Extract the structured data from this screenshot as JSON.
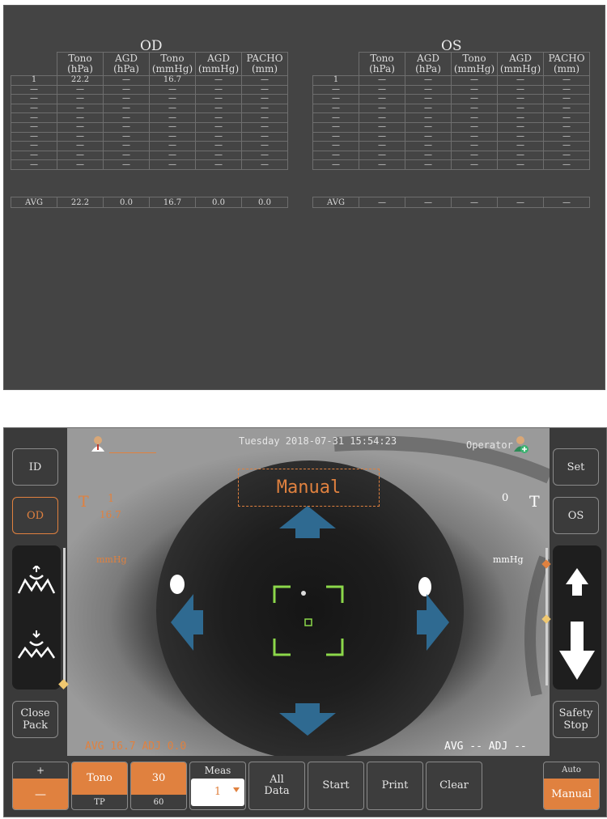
{
  "data_panel": {
    "od": {
      "title": "OD",
      "headers": [
        {
          "line1": "Tono",
          "line2": "(hPa)"
        },
        {
          "line1": "AGD",
          "line2": "(hPa)"
        },
        {
          "line1": "Tono",
          "line2": "(mmHg)"
        },
        {
          "line1": "AGD",
          "line2": "(mmHg)"
        },
        {
          "line1": "PACHO",
          "line2": "(mm)"
        }
      ],
      "rows": [
        [
          "1",
          "22.2",
          "—",
          "16.7",
          "—",
          "—"
        ],
        [
          "—",
          "—",
          "—",
          "—",
          "—",
          "—"
        ],
        [
          "—",
          "—",
          "—",
          "—",
          "—",
          "—"
        ],
        [
          "—",
          "—",
          "—",
          "—",
          "—",
          "—"
        ],
        [
          "—",
          "—",
          "—",
          "—",
          "—",
          "—"
        ],
        [
          "—",
          "—",
          "—",
          "—",
          "—",
          "—"
        ],
        [
          "—",
          "—",
          "—",
          "—",
          "—",
          "—"
        ],
        [
          "—",
          "—",
          "—",
          "—",
          "—",
          "—"
        ],
        [
          "—",
          "—",
          "—",
          "—",
          "—",
          "—"
        ],
        [
          "—",
          "—",
          "—",
          "—",
          "—",
          "—"
        ]
      ],
      "avg": [
        "AVG",
        "22.2",
        "0.0",
        "16.7",
        "0.0",
        "0.0"
      ]
    },
    "os": {
      "title": "OS",
      "headers": [
        {
          "line1": "Tono",
          "line2": "(hPa)"
        },
        {
          "line1": "AGD",
          "line2": "(hPa)"
        },
        {
          "line1": "Tono",
          "line2": "(mmHg)"
        },
        {
          "line1": "AGD",
          "line2": "(mmHg)"
        },
        {
          "line1": "PACHO",
          "line2": "(mm)"
        }
      ],
      "rows": [
        [
          "1",
          "—",
          "—",
          "—",
          "—",
          "—"
        ],
        [
          "—",
          "—",
          "—",
          "—",
          "—",
          "—"
        ],
        [
          "—",
          "—",
          "—",
          "—",
          "—",
          "—"
        ],
        [
          "—",
          "—",
          "—",
          "—",
          "—",
          "—"
        ],
        [
          "—",
          "—",
          "—",
          "—",
          "—",
          "—"
        ],
        [
          "—",
          "—",
          "—",
          "—",
          "—",
          "—"
        ],
        [
          "—",
          "—",
          "—",
          "—",
          "—",
          "—"
        ],
        [
          "—",
          "—",
          "—",
          "—",
          "—",
          "—"
        ],
        [
          "—",
          "—",
          "—",
          "—",
          "—",
          "—"
        ],
        [
          "—",
          "—",
          "—",
          "—",
          "—",
          "—"
        ]
      ],
      "avg": [
        "AVG",
        "—",
        "—",
        "—",
        "—",
        "—"
      ]
    }
  },
  "device": {
    "datetime": "Tuesday 2018-07-31 15:54:23",
    "operator_label": "Operator",
    "mode_label": "Manual",
    "left_side": {
      "letter": "T",
      "count": "1",
      "value": "16.7",
      "unit": "mmHg",
      "avg_line": "AVG 16.7 ADJ 0.0"
    },
    "right_side": {
      "letter": "T",
      "count": "0",
      "unit": "mmHg",
      "avg_line": "AVG -- ADJ --"
    },
    "buttons": {
      "id": "ID",
      "od": "OD",
      "close_pack": "Close Pack",
      "set": "Set",
      "os": "OS",
      "safety_stop": "Safety Stop",
      "plus": "+",
      "minus": "—",
      "tono": "Tono",
      "tp": "TP",
      "pressure_top": "30",
      "pressure_bottom": "60",
      "meas_label": "Meas",
      "meas_value": "1",
      "all_data": "All Data",
      "start": "Start",
      "print": "Print",
      "clear": "Clear",
      "auto": "Auto",
      "manual": "Manual"
    },
    "colors": {
      "accent": "#e0813f",
      "arrow": "#2f6a91",
      "target": "#8cd84a"
    }
  }
}
